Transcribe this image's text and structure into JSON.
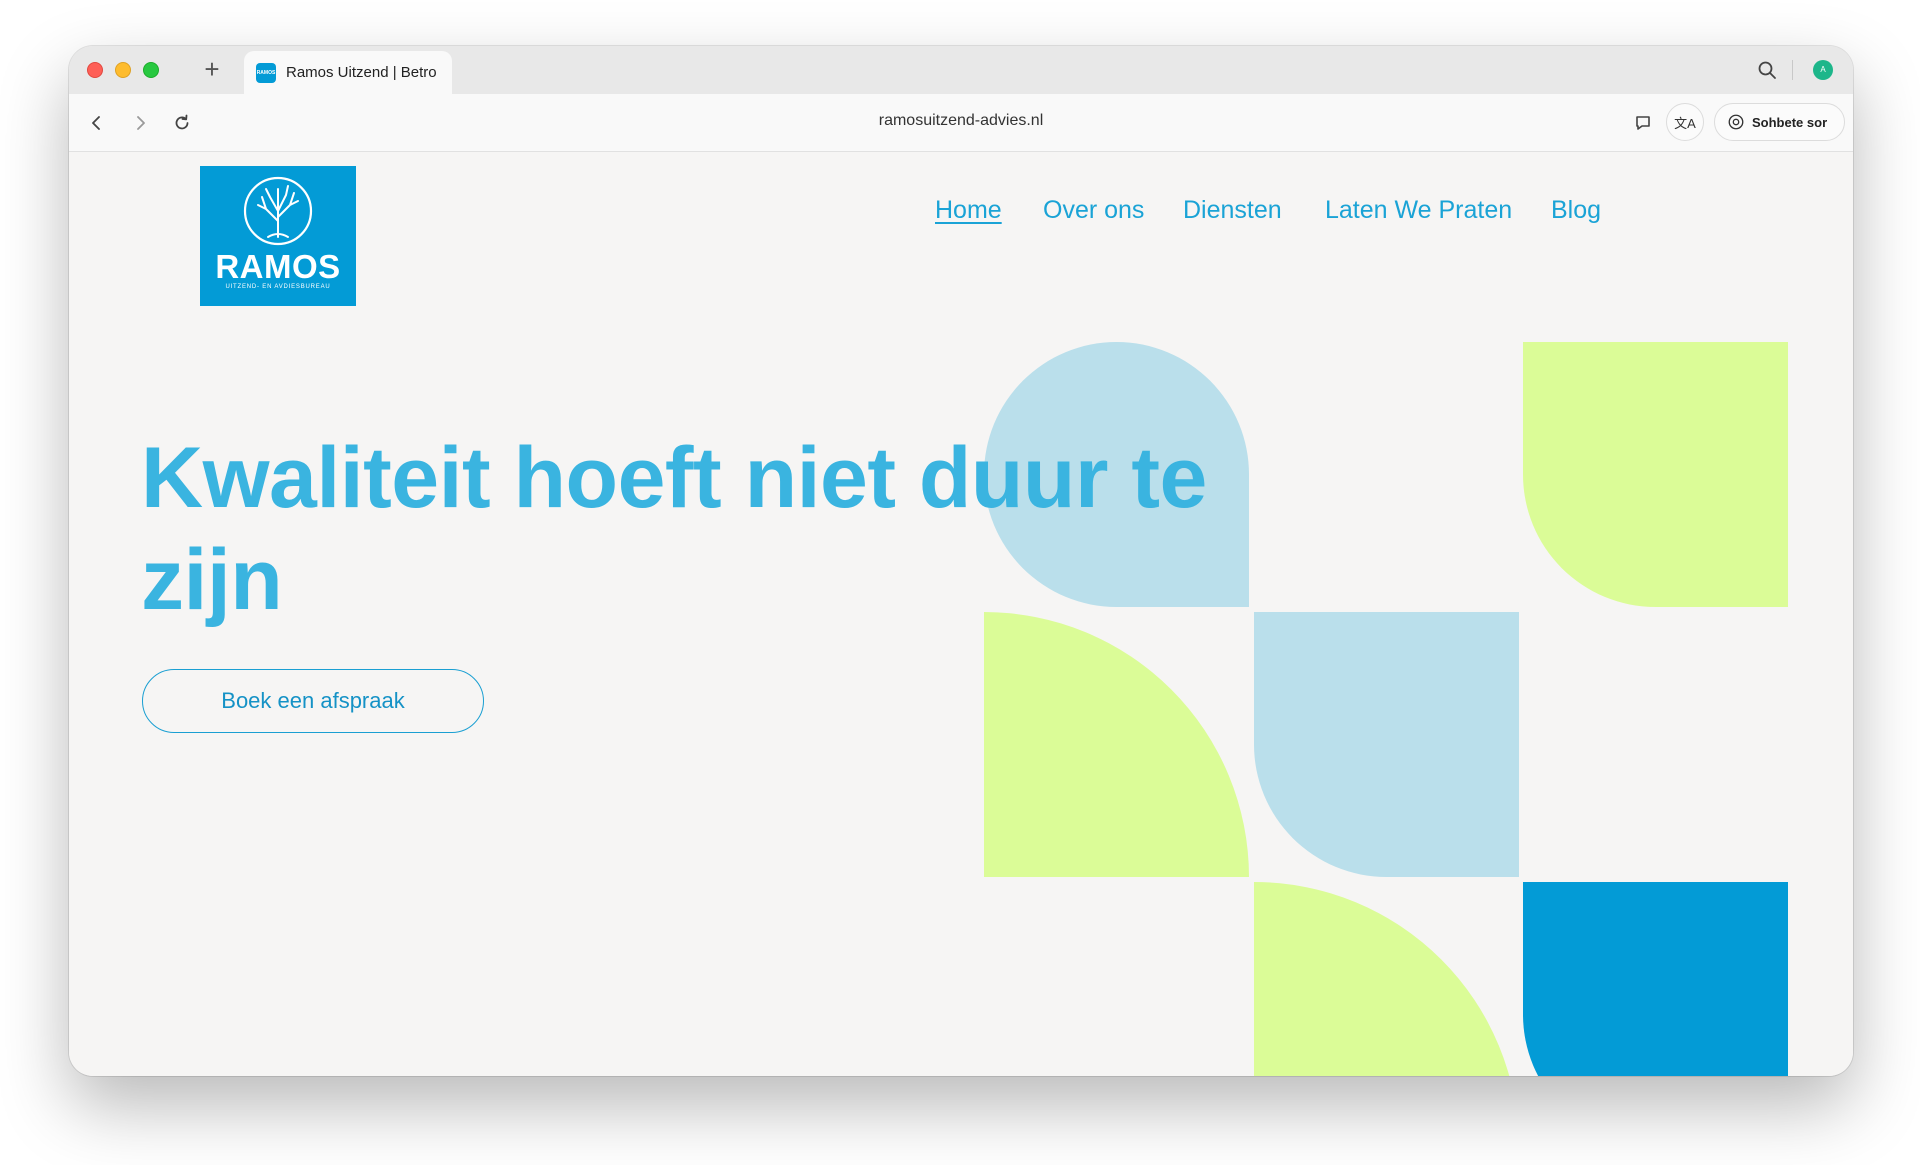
{
  "browser": {
    "tab_title": "Ramos Uitzend | Betro",
    "favicon_text": "RAMOS",
    "url": "ramosuitzend-advies.nl",
    "profile_initial": "A",
    "translate_label": "文A",
    "ai_button_label": "Sohbete sor",
    "icons": {
      "new_tab": "plus-icon",
      "search": "search-icon",
      "back": "chevron-left-icon",
      "forward": "chevron-right-icon",
      "reload": "reload-icon",
      "share": "chat-bubble-icon",
      "translate": "translate-icon",
      "ai": "chatgpt-icon"
    }
  },
  "site": {
    "logo": {
      "name": "RAMOS",
      "tagline": "UITZEND- EN AVDIESBUREAU",
      "icon": "tree-icon"
    },
    "nav": [
      {
        "label": "Home",
        "active": true
      },
      {
        "label": "Over ons",
        "active": false
      },
      {
        "label": "Diensten",
        "active": false
      },
      {
        "label": "Laten We Praten",
        "active": false
      },
      {
        "label": "Blog",
        "active": false
      }
    ],
    "hero": {
      "title": "Kwaliteit hoeft niet duur te zijn",
      "cta_label": "Boek een afspraak"
    },
    "colors": {
      "primary_blue": "#039bd6",
      "heading_blue": "#3ab4e0",
      "light_blue": "#badfeb",
      "lime": "#dbfc97",
      "background": "#f6f5f4"
    }
  }
}
